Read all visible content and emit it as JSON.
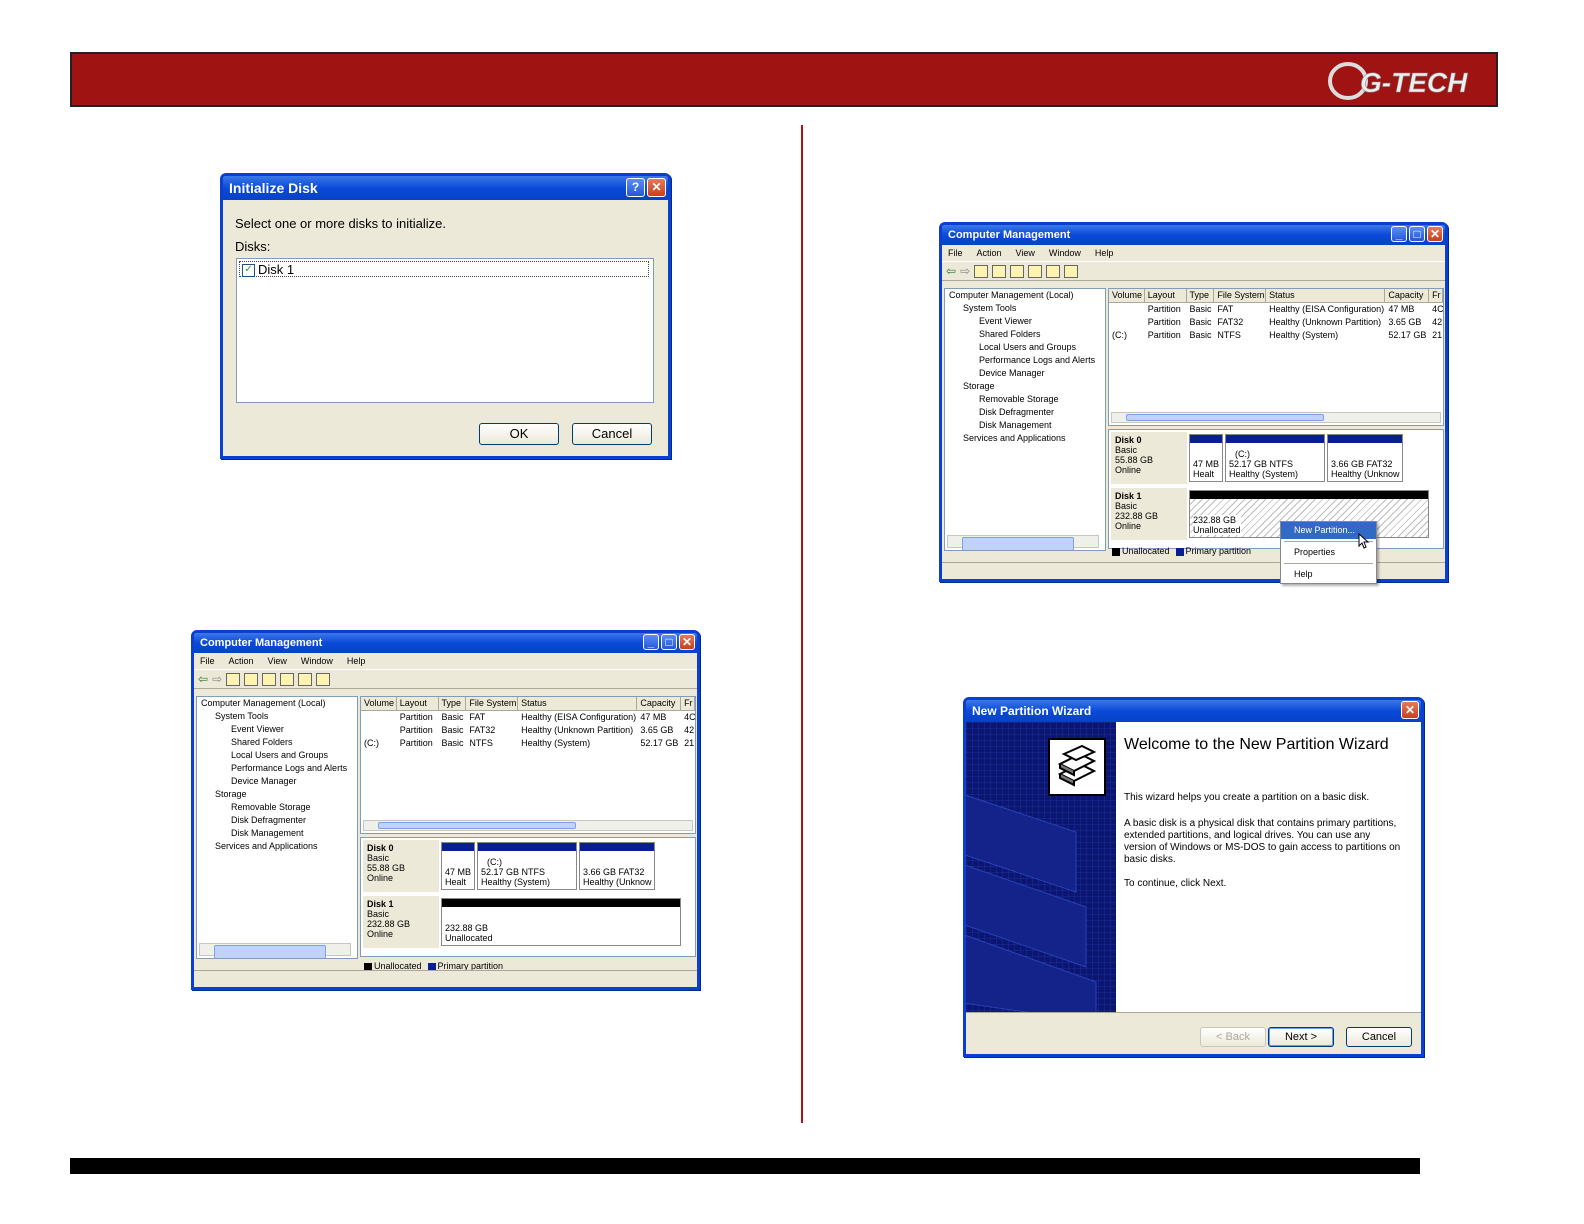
{
  "brand": {
    "logo_text": "G-TECH"
  },
  "init_disk": {
    "title": "Initialize Disk",
    "prompt": "Select one or more disks to initialize.",
    "disks_label": "Disks:",
    "disk_item": "Disk 1",
    "ok": "OK",
    "cancel": "Cancel",
    "help_glyph": "?",
    "close_glyph": "✕"
  },
  "cm": {
    "title": "Computer Management",
    "menu": [
      "File",
      "Action",
      "View",
      "Window",
      "Help"
    ],
    "tree": [
      "Computer Management (Local)",
      "System Tools",
      "Event Viewer",
      "Shared Folders",
      "Local Users and Groups",
      "Performance Logs and Alerts",
      "Device Manager",
      "Storage",
      "Removable Storage",
      "Disk Defragmenter",
      "Disk Management",
      "Services and Applications"
    ],
    "columns": [
      "Volume",
      "Layout",
      "Type",
      "File System",
      "Status",
      "Capacity",
      "Fr"
    ],
    "rows": [
      [
        "",
        "Partition",
        "Basic",
        "FAT",
        "Healthy (EISA Configuration)",
        "47 MB",
        "4C"
      ],
      [
        "",
        "Partition",
        "Basic",
        "FAT32",
        "Healthy (Unknown Partition)",
        "3.65 GB",
        "42"
      ],
      [
        "(C:)",
        "Partition",
        "Basic",
        "NTFS",
        "Healthy (System)",
        "52.17 GB",
        "21"
      ]
    ],
    "disk0": {
      "name": "Disk 0",
      "type": "Basic",
      "size": "55.88 GB",
      "state": "Online"
    },
    "disk0_parts": [
      {
        "l1": "",
        "l2": "47 MB",
        "l3": "Healt"
      },
      {
        "l1": "(C:)",
        "l2": "52.17 GB NTFS",
        "l3": "Healthy (System)"
      },
      {
        "l1": "",
        "l2": "3.66 GB FAT32",
        "l3": "Healthy (Unknow"
      }
    ],
    "disk1": {
      "name": "Disk 1",
      "type": "Basic",
      "size": "232.88 GB",
      "state": "Online"
    },
    "disk1_part": {
      "l1": "232.88 GB",
      "l2": "Unallocated"
    },
    "legend": [
      "Unallocated",
      "Primary partition"
    ],
    "context_menu": [
      "New Partition...",
      "Properties",
      "Help"
    ]
  },
  "wizard": {
    "title": "New Partition Wizard",
    "heading": "Welcome to the New Partition Wizard",
    "p1": "This wizard helps you create a partition on a basic disk.",
    "p2": "A basic disk is a physical disk that contains primary partitions, extended partitions, and logical drives. You can use any version of Windows or MS-DOS to gain access to partitions on basic disks.",
    "p3": "To continue, click Next.",
    "back": "< Back",
    "next": "Next >",
    "cancel": "Cancel"
  },
  "colors": {
    "header": "#a01313",
    "divider": "#b01010",
    "xp_blue": "#0a4ad8",
    "partition_bar": "#0a1f8f"
  }
}
